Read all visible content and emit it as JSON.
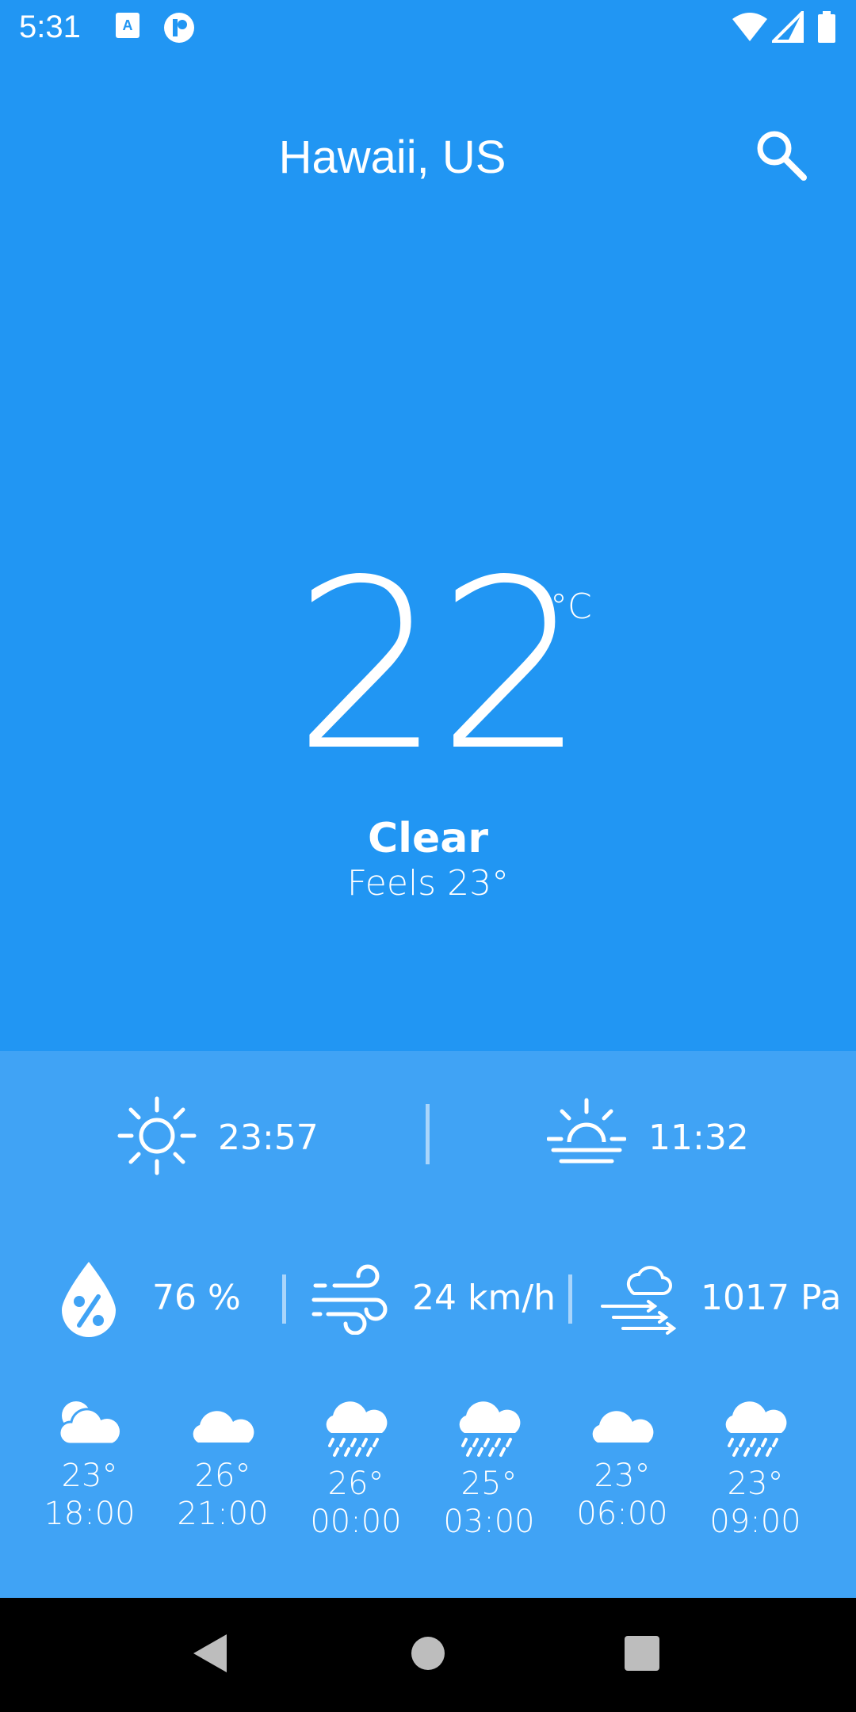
{
  "status_bar": {
    "time": "5:31"
  },
  "header": {
    "location": "Hawaii, US"
  },
  "current": {
    "temperature": "22",
    "unit": "°C",
    "condition": "Clear",
    "feels_like": "Feels 23°"
  },
  "sun": {
    "sunrise": "23:57",
    "sunset": "11:32"
  },
  "metrics": {
    "humidity": "76 %",
    "wind": "24 km/h",
    "pressure": "1017 Pa"
  },
  "hourly": [
    {
      "temp": "23°",
      "time": "18:00",
      "icon": "cloud-sun-icon"
    },
    {
      "temp": "26°",
      "time": "21:00",
      "icon": "cloud-icon"
    },
    {
      "temp": "26°",
      "time": "00:00",
      "icon": "rain-icon"
    },
    {
      "temp": "25°",
      "time": "03:00",
      "icon": "rain-icon"
    },
    {
      "temp": "23°",
      "time": "06:00",
      "icon": "cloud-icon"
    },
    {
      "temp": "23°",
      "time": "09:00",
      "icon": "rain-icon"
    }
  ],
  "colors": {
    "background": "#2196F3",
    "panel": "#40A3F5"
  }
}
